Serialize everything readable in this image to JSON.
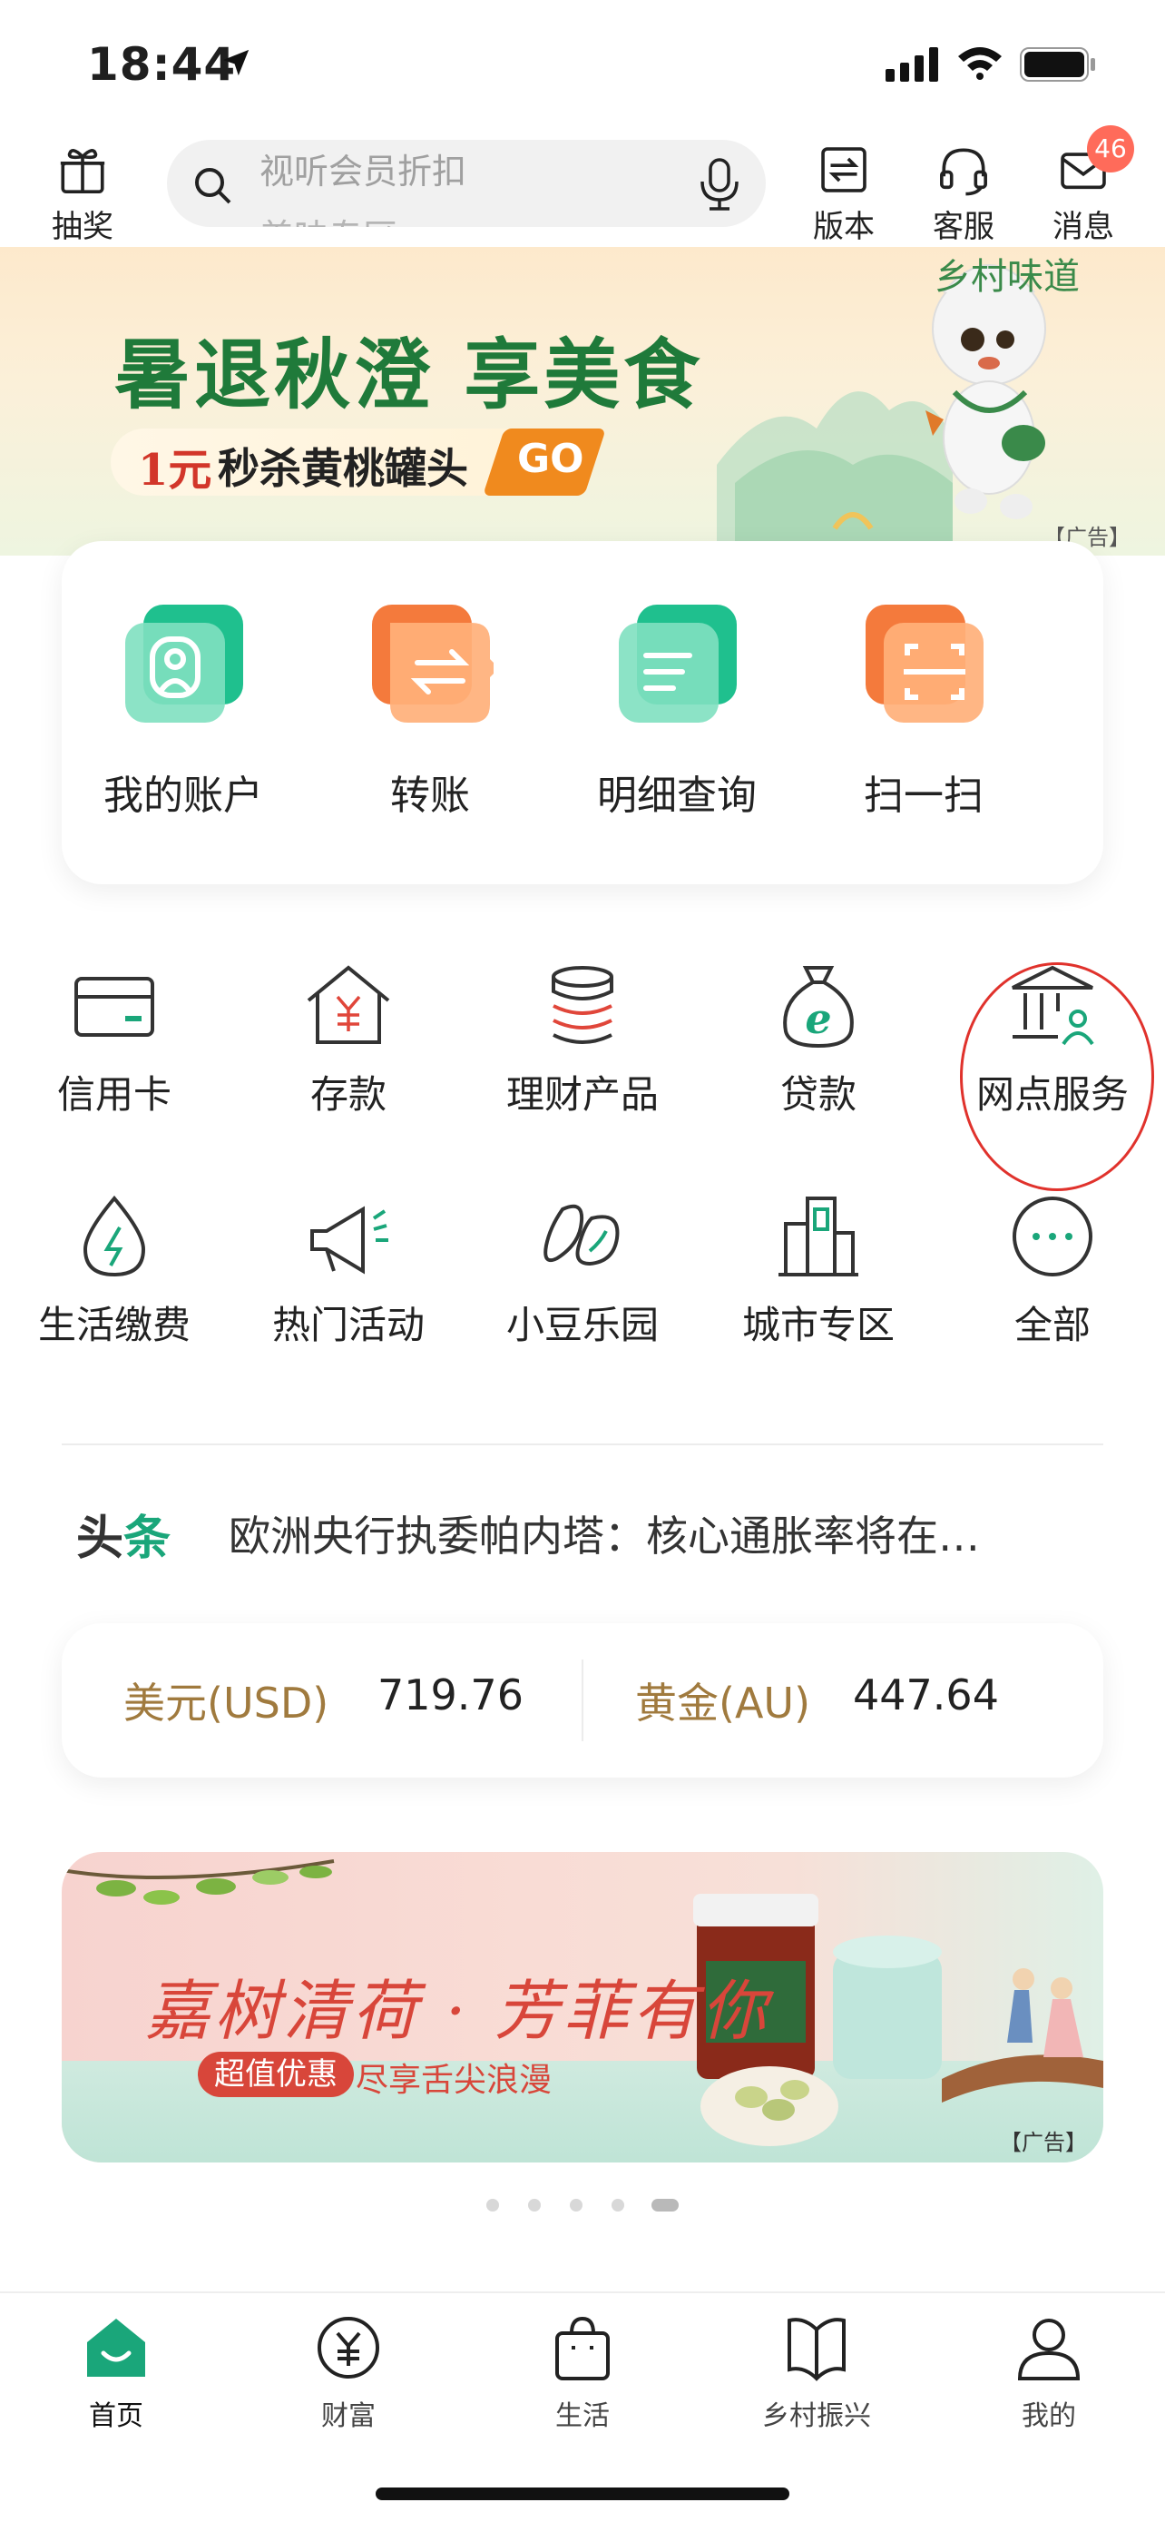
{
  "status_bar": {
    "time": "18:44"
  },
  "header": {
    "lottery_label": "抽奖",
    "search_placeholder": "视听会员折扣",
    "search_placeholder_next": "美味专区",
    "version_label": "版本",
    "service_label": "客服",
    "message_label": "消息",
    "message_badge": "46"
  },
  "top_banner": {
    "title": "暑退秋澄 享美食",
    "promo_num": "1元",
    "promo_text": "秒杀黄桃罐头",
    "go": "GO",
    "brand": "乡村味道",
    "ad_tag": "【广告】"
  },
  "quick_actions": [
    {
      "label": "我的账户",
      "icon": "account-icon"
    },
    {
      "label": "转账",
      "icon": "transfer-icon"
    },
    {
      "label": "明细查询",
      "icon": "statement-icon"
    },
    {
      "label": "扫一扫",
      "icon": "scan-icon"
    }
  ],
  "services_row1": [
    {
      "label": "信用卡",
      "icon": "credit-card-icon"
    },
    {
      "label": "存款",
      "icon": "deposit-icon"
    },
    {
      "label": "理财产品",
      "icon": "wealth-product-icon"
    },
    {
      "label": "贷款",
      "icon": "loan-icon"
    },
    {
      "label": "网点服务",
      "icon": "branch-service-icon"
    }
  ],
  "services_row2": [
    {
      "label": "生活缴费",
      "icon": "utility-payment-icon"
    },
    {
      "label": "热门活动",
      "icon": "megaphone-icon"
    },
    {
      "label": "小豆乐园",
      "icon": "bean-park-icon"
    },
    {
      "label": "城市专区",
      "icon": "city-zone-icon"
    },
    {
      "label": "全部",
      "icon": "more-icon"
    }
  ],
  "headline": {
    "tag_1": "头",
    "tag_2": "条",
    "text": "欧洲央行执委帕内塔：核心通胀率将在…"
  },
  "rates": {
    "usd_label": "美元(USD)",
    "usd_value": "719.76",
    "gold_label": "黄金(AU)",
    "gold_value": "447.64"
  },
  "promo_banner": {
    "title": "嘉树清荷 · 芳菲有你",
    "chip": "超值优惠",
    "subtitle": "尽享舌尖浪漫",
    "ad_tag": "【广告】"
  },
  "pager": {
    "count": 5,
    "active": 5
  },
  "tab_bar": [
    {
      "label": "首页",
      "icon": "home-icon",
      "active": true
    },
    {
      "label": "财富",
      "icon": "wealth-icon"
    },
    {
      "label": "生活",
      "icon": "shopping-bag-icon"
    },
    {
      "label": "乡村振兴",
      "icon": "book-icon"
    },
    {
      "label": "我的",
      "icon": "profile-icon"
    }
  ],
  "colors": {
    "accent_green": "#1aa67a",
    "orange": "#f47a3c",
    "badge_red": "#ff6b5a",
    "gold_text": "#a07a3e"
  }
}
